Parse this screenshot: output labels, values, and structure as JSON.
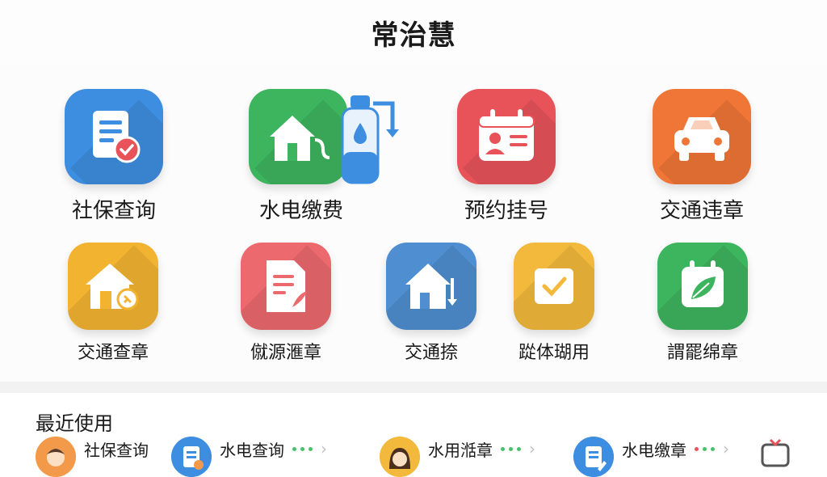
{
  "header": {
    "title": "常治慧"
  },
  "services_row1": [
    {
      "label": "社保查询",
      "icon": "document-check-icon",
      "color": "#3d8ee0"
    },
    {
      "label": "水电缴费",
      "icon": "house-water-icon",
      "color": "#3db55e"
    },
    {
      "label": "预约挂号",
      "icon": "calendar-id-card-icon",
      "color": "#e8535a"
    },
    {
      "label": "交通违章",
      "icon": "car-icon",
      "color": "#ef7636"
    }
  ],
  "services_row2": [
    {
      "label": "交通查章",
      "icon": "house-pin-icon",
      "color": "#f2b331"
    },
    {
      "label": "僦源滙章",
      "icon": "document-edit-icon",
      "color": "#ec6a6e"
    },
    {
      "label": "交通捺",
      "icon": "house-arrow-icon",
      "color": "#4f8fd1"
    },
    {
      "label": "踨体瑚用",
      "icon": "checkbox-icon",
      "color": "#f3b93c"
    },
    {
      "label": "謂罷绵章",
      "icon": "calendar-leaf-icon",
      "color": "#3db55e"
    }
  ],
  "recent": {
    "heading": "最近使用",
    "items": [
      {
        "label": "社保查询",
        "icon": "user-avatar-icon"
      },
      {
        "label": "水电查询",
        "icon": "document-icon"
      },
      {
        "label": "水用湉章",
        "icon": "user-avatar-female-icon"
      },
      {
        "label": "水电缴章",
        "icon": "document-edit-icon"
      }
    ]
  }
}
